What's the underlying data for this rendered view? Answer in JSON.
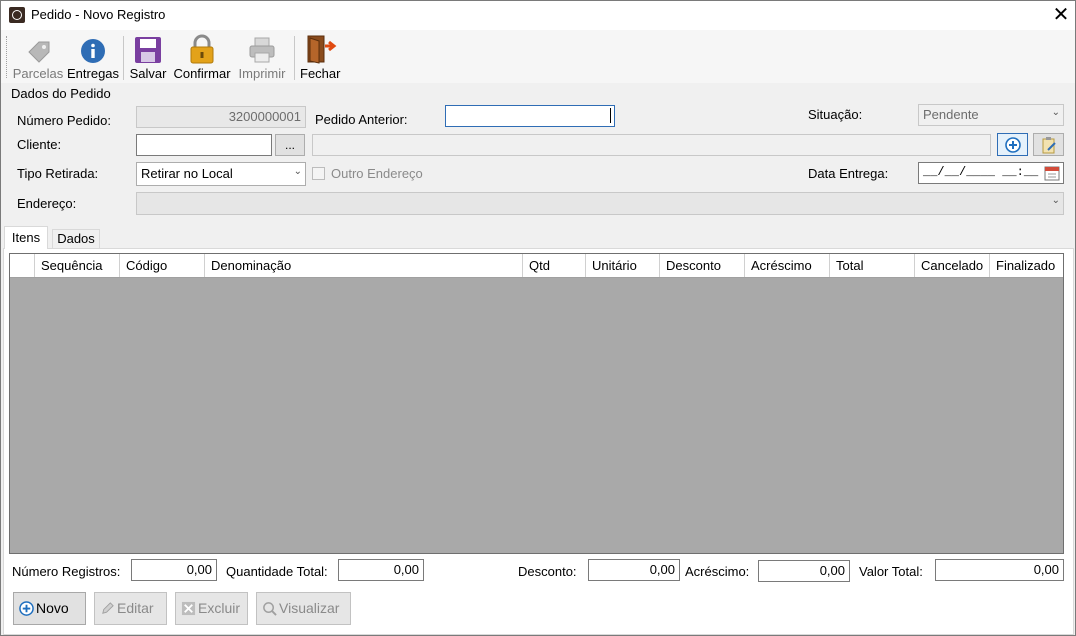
{
  "window": {
    "title": "Pedido - Novo Registro",
    "close_glyph": "✕"
  },
  "toolbar": {
    "items": [
      {
        "label": "Parcelas",
        "icon": "tag-icon",
        "enabled": false
      },
      {
        "label": "Entregas",
        "icon": "info-icon",
        "enabled": true
      },
      {
        "label": "Salvar",
        "icon": "save-icon",
        "enabled": true
      },
      {
        "label": "Confirmar",
        "icon": "lock-icon",
        "enabled": true
      },
      {
        "label": "Imprimir",
        "icon": "printer-icon",
        "enabled": false
      },
      {
        "label": "Fechar",
        "icon": "exit-door-icon",
        "enabled": true
      }
    ]
  },
  "form": {
    "group_title": "Dados do Pedido",
    "numero_pedido": {
      "label": "Número Pedido:",
      "value": "3200000001"
    },
    "pedido_anterior": {
      "label": "Pedido Anterior:",
      "value": ""
    },
    "situacao": {
      "label": "Situação:",
      "value": "Pendente"
    },
    "cliente": {
      "label": "Cliente:",
      "code": "",
      "lookup_label": "...",
      "name": ""
    },
    "tipo_retirada": {
      "label": "Tipo Retirada:",
      "value": "Retirar no Local"
    },
    "outro_endereco": {
      "label": "Outro Endereço",
      "checked": false
    },
    "data_entrega": {
      "label": "Data Entrega:",
      "mask": "__/__/____ __:__"
    },
    "endereco": {
      "label": "Endereço:",
      "value": ""
    }
  },
  "tabs": [
    {
      "label": "Itens",
      "active": true
    },
    {
      "label": "Dados",
      "active": false
    }
  ],
  "grid": {
    "columns": [
      "",
      "Sequência",
      "Código",
      "Denominação",
      "Qtd",
      "Unitário",
      "Desconto",
      "Acréscimo",
      "Total",
      "Cancelado",
      "Finalizado"
    ],
    "rows": []
  },
  "totals": {
    "numero_registros": {
      "label": "Número Registros:",
      "value": "0,00"
    },
    "quantidade_total": {
      "label": "Quantidade Total:",
      "value": "0,00"
    },
    "desconto": {
      "label": "Desconto:",
      "value": "0,00"
    },
    "acrescimo": {
      "label": "Acréscimo:",
      "value": "0,00"
    },
    "valor_total": {
      "label": "Valor Total:",
      "value": "0,00"
    }
  },
  "actions": [
    {
      "label": "Novo",
      "icon": "add-circle-icon",
      "enabled": true
    },
    {
      "label": "Editar",
      "icon": "edit-icon",
      "enabled": false
    },
    {
      "label": "Excluir",
      "icon": "delete-icon",
      "enabled": false
    },
    {
      "label": "Visualizar",
      "icon": "magnifier-icon",
      "enabled": false
    }
  ],
  "colors": {
    "accent_blue": "#1f6fbf",
    "grid_bg": "#a9a9a9",
    "save_purple": "#7a3fa0",
    "lock_gold": "#e3a21a"
  }
}
